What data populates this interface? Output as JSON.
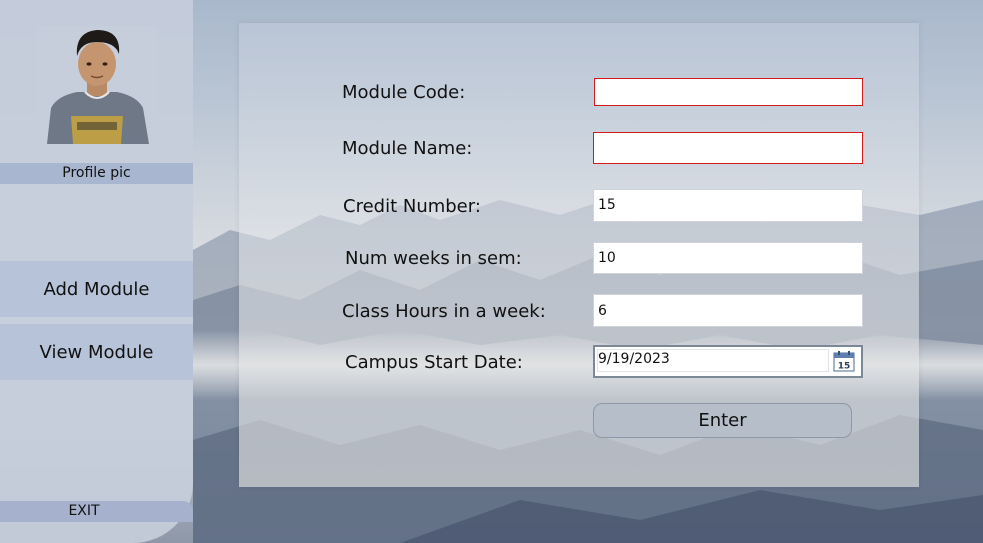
{
  "sidebar": {
    "profile_label": "Profile pic",
    "add_module_label": "Add Module",
    "view_module_label": "View Module",
    "exit_label": "EXIT"
  },
  "form": {
    "module_code": {
      "label": "Module Code:",
      "value": "",
      "state": "error"
    },
    "module_name": {
      "label": "Module Name:",
      "value": "",
      "state": "error"
    },
    "credit_number": {
      "label": "Credit Number:",
      "value": "15"
    },
    "weeks_in_sem": {
      "label": "Num weeks in sem:",
      "value": "10"
    },
    "class_hours": {
      "label": "Class Hours in a week:",
      "value": "6"
    },
    "start_date": {
      "label": "Campus Start Date:",
      "value": "9/19/2023",
      "calendar_icon_day": "15"
    },
    "enter_label": "Enter"
  },
  "colors": {
    "error_border": "#d41a1a",
    "sidebar_bg": "#c6cedc",
    "nav_button_bg": "#b7c3d8",
    "label_strip_bg": "#a9b6d0",
    "enter_button_bg": "#b6bec9"
  },
  "icons": {
    "calendar": "calendar-icon",
    "avatar": "avatar-photo"
  }
}
